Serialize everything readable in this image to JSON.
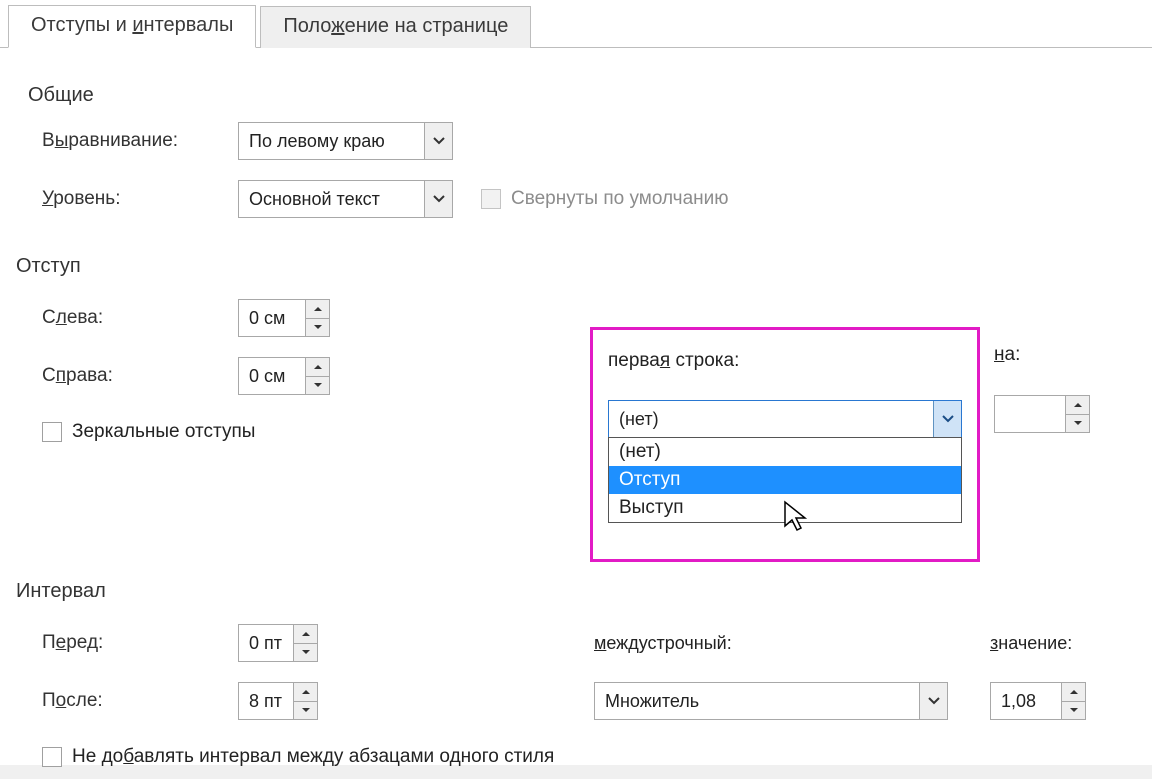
{
  "tabs": {
    "indents_prefix": "Отступы и ",
    "indents_ul": "и",
    "indents_suffix": "нтервалы",
    "position_prefix": "Поло",
    "position_ul": "ж",
    "position_suffix": "ение на странице"
  },
  "general": {
    "title": "Общие",
    "alignment_prefix": "В",
    "alignment_ul": "ы",
    "alignment_suffix": "равнивание:",
    "alignment_value": "По левому краю",
    "level_prefix": "",
    "level_ul": "У",
    "level_suffix": "ровень:",
    "level_value": "Основной текст",
    "collapsed_label": "Свернуты по умолчанию"
  },
  "indent": {
    "title": "Отступ",
    "left_prefix": "С",
    "left_ul": "л",
    "left_suffix": "ева:",
    "left_value": "0 см",
    "right_prefix": "С",
    "right_ul": "п",
    "right_suffix": "рава:",
    "right_value": "0 см",
    "mirror_label": "Зеркальные отступы",
    "firstline_prefix": "перва",
    "firstline_ul": "я",
    "firstline_suffix": " строка:",
    "firstline_value": "(нет)",
    "firstline_options": [
      "(нет)",
      "Отступ",
      "Выступ"
    ],
    "firstline_selected_index": 1,
    "na_ul": "н",
    "na_suffix": "а:",
    "na_value": ""
  },
  "spacing": {
    "title": "Интервал",
    "before_prefix": "П",
    "before_ul": "е",
    "before_suffix": "ред:",
    "before_value": "0 пт",
    "after_prefix": "П",
    "after_ul": "о",
    "after_suffix": "сле:",
    "after_value": "8 пт",
    "line_prefix": "",
    "line_ul": "м",
    "line_suffix": "еждустрочный:",
    "line_value": "Множитель",
    "linevalue_prefix": "",
    "linevalue_ul": "з",
    "linevalue_suffix": "начение:",
    "linevalue_value": "1,08",
    "noaddspace_prefix": "Не до",
    "noaddspace_ul": "б",
    "noaddspace_suffix": "авлять интервал между абзацами одного стиля"
  }
}
